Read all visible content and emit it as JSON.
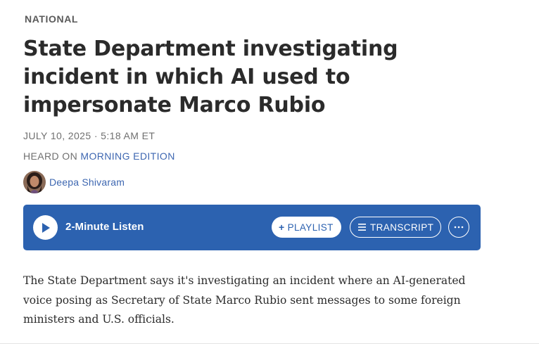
{
  "article": {
    "section": "NATIONAL",
    "headline": "State Department investigating incident in which AI used to impersonate Marco Rubio",
    "dateline": "JULY 10, 2025 · 5:18 AM ET",
    "heard_on_prefix": "HEARD ON ",
    "heard_on_program": "MORNING EDITION",
    "author": "Deepa Shivaram",
    "body": "The State Department says it's investigating an incident where an AI-generated voice posing as Secretary of State Marco Rubio sent messages to some foreign ministers and U.S. officials."
  },
  "player": {
    "listen_label": "2-Minute Listen",
    "playlist_label": "PLAYLIST",
    "transcript_label": "TRANSCRIPT",
    "icons": {
      "play": "play-icon",
      "playlist": "plus-icon",
      "transcript": "lines-icon",
      "more": "more-dots-icon"
    }
  },
  "colors": {
    "player_bg": "#2c62b0",
    "link": "#3e67b1",
    "text": "#2b2b2b",
    "meta": "#707070"
  }
}
